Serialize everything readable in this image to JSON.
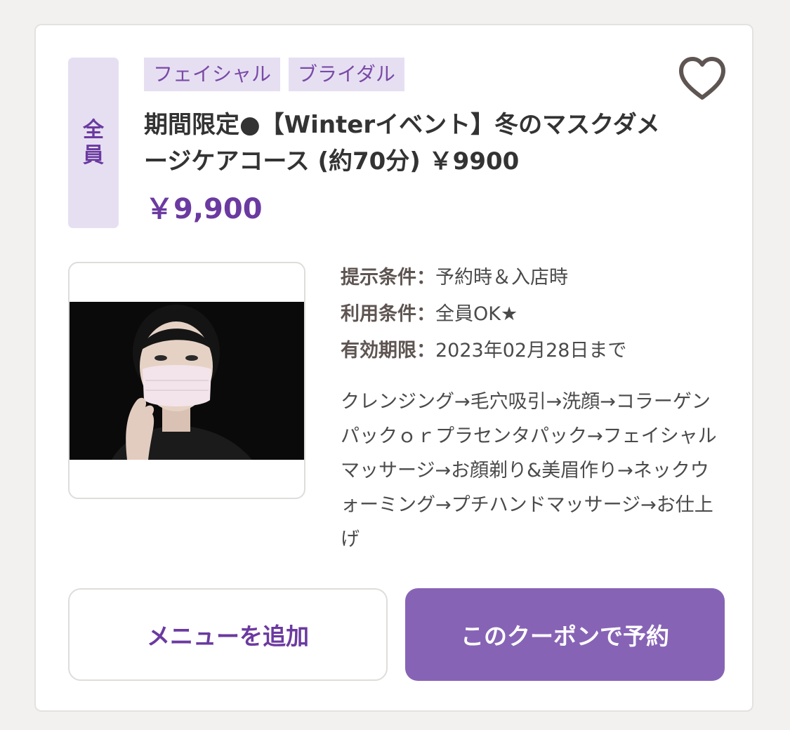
{
  "coupon": {
    "target_badge": [
      "全",
      "員"
    ],
    "tags": [
      "フェイシャル",
      "ブライダル"
    ],
    "favorite_icon": "heart-outline-icon",
    "title": "期間限定●【Winterイベント】冬のマスクダメージケアコース (約70分) ￥9900",
    "price": "￥9,900",
    "photo_alt": "mask-wearing-woman-photo",
    "conditions": [
      {
        "label": "提示条件：",
        "value": "予約時＆入店時"
      },
      {
        "label": "利用条件：",
        "value": "全員OK★"
      },
      {
        "label": "有効期限：",
        "value": "2023年02月28日まで"
      }
    ],
    "description": "クレンジング→毛穴吸引→洗顔→コラーゲンパックｏｒプラセンタパック→フェイシャルマッサージ→お顔剃り&美眉作り→ネックウォーミング→プチハンドマッサージ→お仕上げ",
    "buttons": {
      "add_menu": "メニューを追加",
      "reserve": "このクーポンで予約"
    },
    "colors": {
      "accent": "#6b3aa0",
      "button_primary": "#8763b5",
      "tag_background": "#e6dff2"
    }
  }
}
